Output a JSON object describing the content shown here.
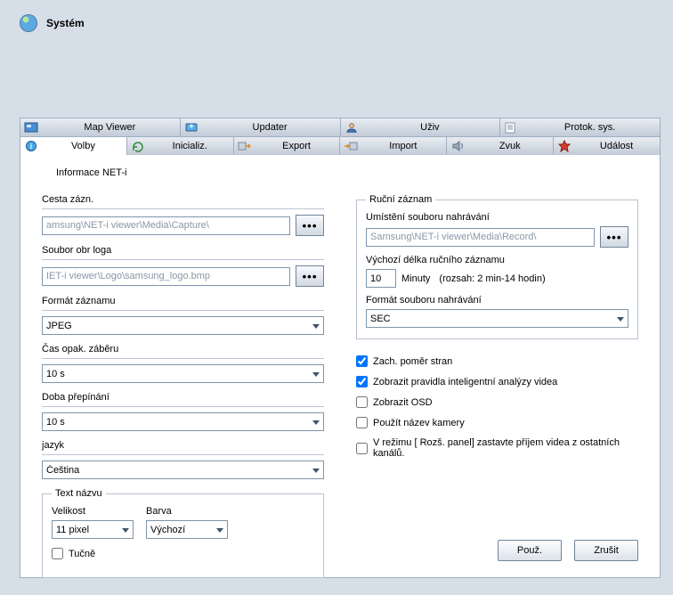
{
  "title": "Systém",
  "top_tabs": [
    {
      "label": "Map Viewer"
    },
    {
      "label": "Updater"
    },
    {
      "label": "Uživ"
    },
    {
      "label": "Protok. sys."
    }
  ],
  "sec_tabs": [
    {
      "label": "Volby"
    },
    {
      "label": "Inicializ."
    },
    {
      "label": "Export"
    },
    {
      "label": "Import"
    },
    {
      "label": "Zvuk"
    },
    {
      "label": "Událost"
    }
  ],
  "header": "Informace NET-i",
  "left": {
    "record_path_label": "Cesta zázn.",
    "record_path_value": "amsung\\NET-i viewer\\Media\\Capture\\",
    "logo_file_label": "Soubor obr loga",
    "logo_file_value": "IET-i viewer\\Logo\\samsung_logo.bmp",
    "format_label": "Formát záznamu",
    "format_value": "JPEG",
    "repeat_label": "Čas opak. záběru",
    "repeat_value": "10 s",
    "switch_label": "Doba přepínání",
    "switch_value": "10 s",
    "lang_label": "jazyk",
    "lang_value": "Čeština",
    "title_group": "Text názvu",
    "size_label": "Velikost",
    "size_value": "11 pixel",
    "color_label": "Barva",
    "color_value": "Výchozí",
    "bold_label": "Tučně"
  },
  "right": {
    "group": "Ruční záznam",
    "loc_label": "Umístění souboru nahrávání",
    "loc_value": "Samsung\\NET-i viewer\\Media\\Record\\",
    "dur_label": "Výchozí délka ručního záznamu",
    "dur_value": "10",
    "dur_unit": "Minuty",
    "dur_range": "(rozsah: 2 min-14 hodin)",
    "rec_format_label": "Formát souboru nahrávání",
    "rec_format_value": "SEC",
    "chk_aspect": "Zach. poměr stran",
    "chk_iva": "Zobrazit pravidla inteligentní analýzy videa",
    "chk_osd": "Zobrazit OSD",
    "chk_camname": "Použít název kamery",
    "chk_exp": "V režimu [ Rozš. panel] zastavte příjem videa z ostatních kanálů."
  },
  "buttons": {
    "apply": "Použ.",
    "cancel": "Zrušit"
  },
  "browse": "•••"
}
